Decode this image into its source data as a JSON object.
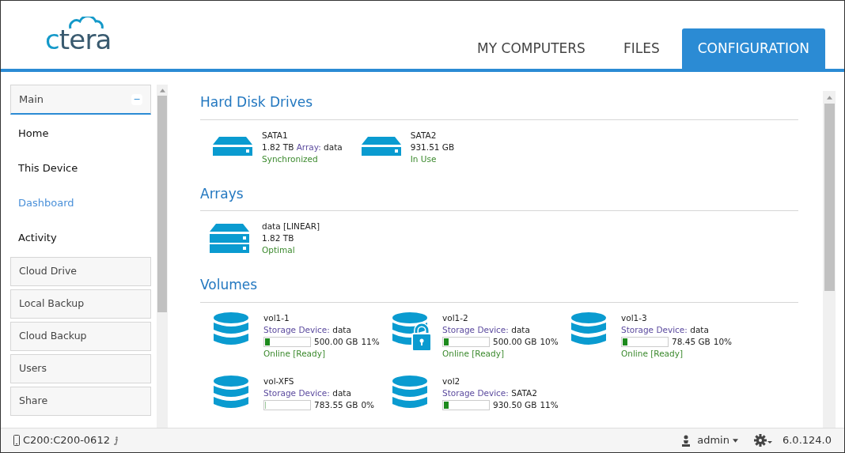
{
  "logo": {
    "text": "ctera"
  },
  "tabs": [
    {
      "label": "MY COMPUTERS",
      "selected": false
    },
    {
      "label": "FILES",
      "selected": false
    },
    {
      "label": "CONFIGURATION",
      "selected": true
    }
  ],
  "sidebar": {
    "main": {
      "label": "Main",
      "expanded": true,
      "toggle": "−",
      "items": [
        {
          "label": "Home",
          "selected": false
        },
        {
          "label": "This Device",
          "selected": false
        },
        {
          "label": "Dashboard",
          "selected": true
        },
        {
          "label": "Activity",
          "selected": false
        }
      ]
    },
    "sections": [
      "Cloud Drive",
      "Local Backup",
      "Cloud Backup",
      "Users",
      "Share"
    ]
  },
  "hard_disk_drives": {
    "title": "Hard Disk Drives",
    "items": [
      {
        "name": "SATA1",
        "size": "1.82 TB",
        "array_label": "Array:",
        "array": "data",
        "status": "Synchronized"
      },
      {
        "name": "SATA2",
        "size": "931.51 GB",
        "status": "In Use"
      }
    ]
  },
  "arrays": {
    "title": "Arrays",
    "items": [
      {
        "name": "data [LINEAR]",
        "size": "1.82 TB",
        "status": "Optimal"
      }
    ]
  },
  "volumes": {
    "title": "Volumes",
    "items": [
      {
        "name": "vol1-1",
        "device_label": "Storage Device:",
        "device": "data",
        "level": 0.11,
        "size": "500.00 GB",
        "percent": "11%",
        "status": "Online [Ready]",
        "locked": false
      },
      {
        "name": "vol1-2",
        "device_label": "Storage Device:",
        "device": "data",
        "level": 0.1,
        "size": "500.00 GB",
        "percent": "10%",
        "status": "Online [Ready]",
        "locked": true
      },
      {
        "name": "vol1-3",
        "device_label": "Storage Device:",
        "device": "data",
        "level": 0.1,
        "size": "78.45 GB",
        "percent": "10%",
        "status": "Online [Ready]",
        "locked": false
      },
      {
        "name": "vol-XFS",
        "device_label": "Storage Device:",
        "device": "data",
        "level": 0,
        "size": "783.55 GB",
        "percent": "0%",
        "locked": false
      },
      {
        "name": "vol2",
        "device_label": "Storage Device:",
        "device": "SATA2",
        "level": 0.11,
        "size": "930.50 GB",
        "percent": "11%",
        "locked": false
      }
    ]
  },
  "status_bar": {
    "device": "C200:C200-0612",
    "user": "admin",
    "version": "6.0.124.0"
  }
}
